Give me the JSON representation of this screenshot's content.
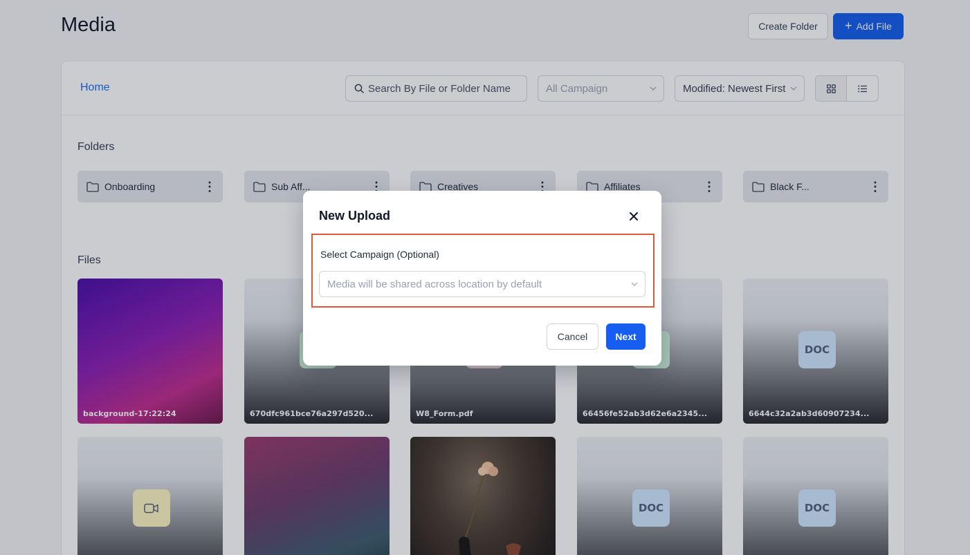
{
  "header": {
    "title": "Media",
    "create_folder_label": "Create Folder",
    "add_file_label": "Add File"
  },
  "toolbar": {
    "breadcrumb": "Home",
    "search_placeholder": "Search By File or Folder Name",
    "campaign_select": "All Campaign",
    "sort_select": "Modified: Newest First"
  },
  "folders_section": {
    "label": "Folders",
    "items": [
      {
        "name": "Onboarding"
      },
      {
        "name": "Sub Aff..."
      },
      {
        "name": "Creatives"
      },
      {
        "name": "Affiliates"
      },
      {
        "name": "Black F..."
      }
    ]
  },
  "files_section": {
    "label": "Files",
    "items": [
      {
        "name": "background-17:22:24",
        "kind": "image"
      },
      {
        "name": "670dfc961bce76a297d520...",
        "kind": "file"
      },
      {
        "name": "W8_Form.pdf",
        "kind": "pdf"
      },
      {
        "name": "66456fe52ab3d62e6a2345...",
        "kind": "file"
      },
      {
        "name": "6644c32a2ab3d60907234...",
        "kind": "doc",
        "badge": "DOC"
      },
      {
        "name": "",
        "kind": "video"
      },
      {
        "name": "",
        "kind": "image"
      },
      {
        "name": "",
        "kind": "photo"
      },
      {
        "name": "",
        "kind": "doc",
        "badge": "DOC"
      },
      {
        "name": "",
        "kind": "doc",
        "badge": "DOC"
      }
    ]
  },
  "modal": {
    "title": "New Upload",
    "field_label": "Select Campaign (Optional)",
    "field_placeholder": "Media will be shared across location by default",
    "cancel_label": "Cancel",
    "next_label": "Next"
  },
  "colors": {
    "primary": "#155eef",
    "link": "#1570ef",
    "highlight": "#e0573a"
  }
}
